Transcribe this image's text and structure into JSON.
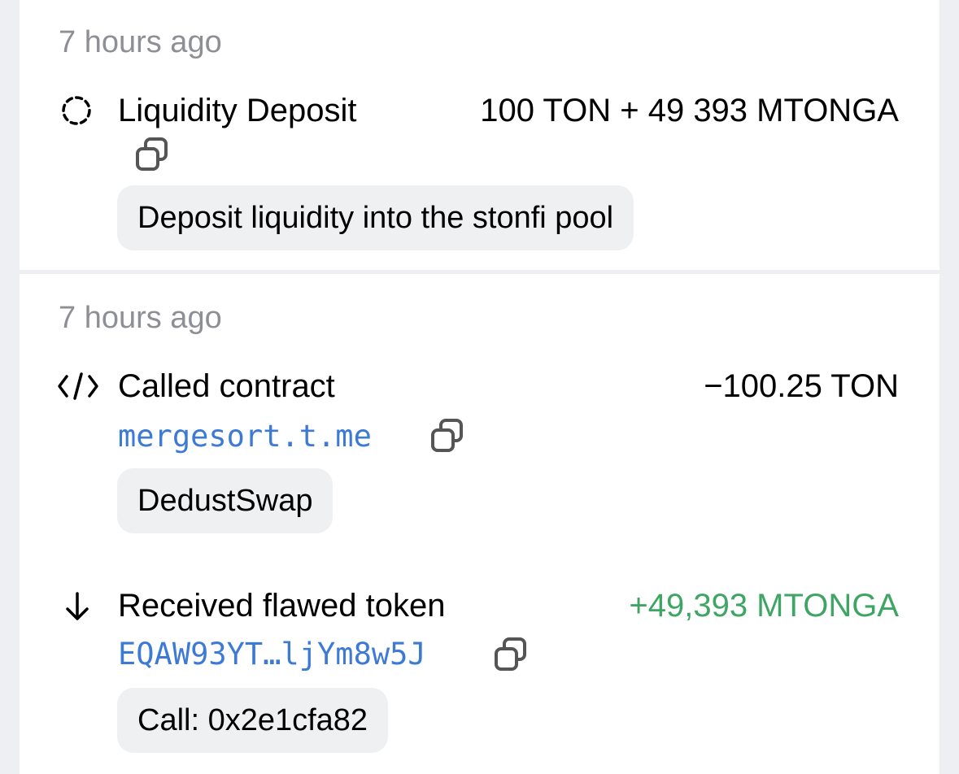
{
  "events": [
    {
      "time": "7 hours ago",
      "action": "Liquidity Deposit",
      "amount": "100 TON + 49 393 MTONGA",
      "icon": "loading-dashed-circle-icon",
      "comment": "Deposit liquidity into the stonfi pool"
    },
    {
      "time": "7 hours ago",
      "actions": [
        {
          "action": "Called contract",
          "amount": "−100.25 TON",
          "icon": "code-icon",
          "address": "mergesort.t.me",
          "comment": "DedustSwap"
        },
        {
          "action": "Received flawed token",
          "amount": "+49,393 MTONGA",
          "amount_color": "#3fa564",
          "icon": "arrow-down-icon",
          "address": "EQAW93YT…ljYm8w5J",
          "comment": "Call: 0x2e1cfa82"
        }
      ]
    }
  ]
}
